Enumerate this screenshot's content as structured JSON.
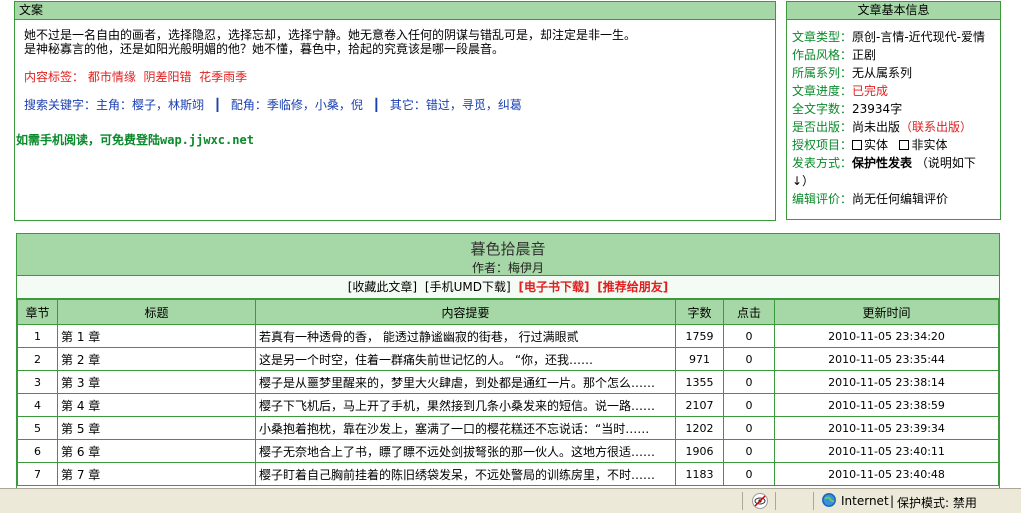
{
  "summary": {
    "header": "文案",
    "line1": "她不过是一名自由的画者，选择隐忍，选择忘却，选择宁静。她无意卷入任何的阴谋与错乱可是，却注定是非一生。",
    "line2": "是神秘寡言的他，还是如阳光般明媚的他？她不懂，暮色中，拾起的究竟该是哪一段晨音。",
    "tags_label": "内容标签：",
    "tags": [
      "都市情缘",
      "阴差阳错",
      "花季雨季"
    ],
    "kw_label": "搜索关键字：",
    "kw_main": "主角：樱子，林斯翊",
    "kw_support": "配角：季临修，小桑，倪",
    "kw_other": "其它：错过，寻觅，纠葛",
    "kw_sep": "┃",
    "mobile": "如需手机阅读，可免费登陆wap.jjwxc.net"
  },
  "info": {
    "header": "文章基本信息",
    "type_label": "文章类型：",
    "type_value": "原创-言情-近代现代-爱情",
    "style_label": "作品风格：",
    "style_value": "正剧",
    "series_label": "所属系列：",
    "series_value": "无从属系列",
    "progress_label": "文章进度：",
    "progress_value": "已完成",
    "words_label": "全文字数：",
    "words_value": "23934字",
    "publish_label": "是否出版：",
    "publish_value": "尚未出版",
    "publish_link": "（联系出版）",
    "rights_label": "授权项目：",
    "rights_a": "实体",
    "rights_b": "非实体",
    "method_label": "发表方式：",
    "method_value": "保护性发表",
    "method_note": "（说明如下",
    "method_arrow": "↓）",
    "eval_label": "编辑评价：",
    "eval_value": "尚无任何编辑评价"
  },
  "novel": {
    "title": "暮色拾晨音",
    "author": "作者：梅伊月",
    "actions": {
      "favorite": "[收藏此文章]",
      "umd": "[手机UMD下载]",
      "ebook": "[电子书下载]",
      "recommend": "[推荐给朋友]"
    }
  },
  "table": {
    "headers": [
      "章节",
      "标题",
      "内容提要",
      "字数",
      "点击",
      "更新时间"
    ],
    "rows": [
      {
        "no": "1",
        "title": "第 1 章",
        "summary": "若真有一种透骨的香，  能透过静谧幽寂的街巷，  行过满眼贰",
        "words": "1759",
        "clicks": "0",
        "time": "2010-11-05 23:34:20"
      },
      {
        "no": "2",
        "title": "第 2 章",
        "summary": "这是另一个时空，住着一群痛失前世记忆的人。  “你，还我……",
        "words": "971",
        "clicks": "0",
        "time": "2010-11-05 23:35:44"
      },
      {
        "no": "3",
        "title": "第 3 章",
        "summary": "樱子是从噩梦里醒来的，梦里大火肆虐，到处都是通红一片。那个怎么……",
        "words": "1355",
        "clicks": "0",
        "time": "2010-11-05 23:38:14"
      },
      {
        "no": "4",
        "title": "第 4 章",
        "summary": "樱子下飞机后，马上开了手机，果然接到几条小桑发来的短信。说一路……",
        "words": "2107",
        "clicks": "0",
        "time": "2010-11-05 23:38:59"
      },
      {
        "no": "5",
        "title": "第 5 章",
        "summary": "小桑抱着抱枕，靠在沙发上，塞满了一口的樱花糕还不忘说话：“当时……",
        "words": "1202",
        "clicks": "0",
        "time": "2010-11-05 23:39:34"
      },
      {
        "no": "6",
        "title": "第 6 章",
        "summary": "樱子无奈地合上了书，瞟了瞟不远处剑拔弩张的那一伙人。这地方很适……",
        "words": "1906",
        "clicks": "0",
        "time": "2010-11-05 23:40:11"
      },
      {
        "no": "7",
        "title": "第 7 章",
        "summary": "樱子盯着自己胸前挂着的陈旧绣袋发呆，不远处警局的训练房里，不时……",
        "words": "1183",
        "clicks": "0",
        "time": "2010-11-05 23:40:48"
      }
    ]
  },
  "statusbar": {
    "zone": "Internet",
    "protected_mode": "保护模式: 禁用",
    "zone_icon": "globe-icon",
    "privacy_icon": "privacy-eye-icon"
  }
}
